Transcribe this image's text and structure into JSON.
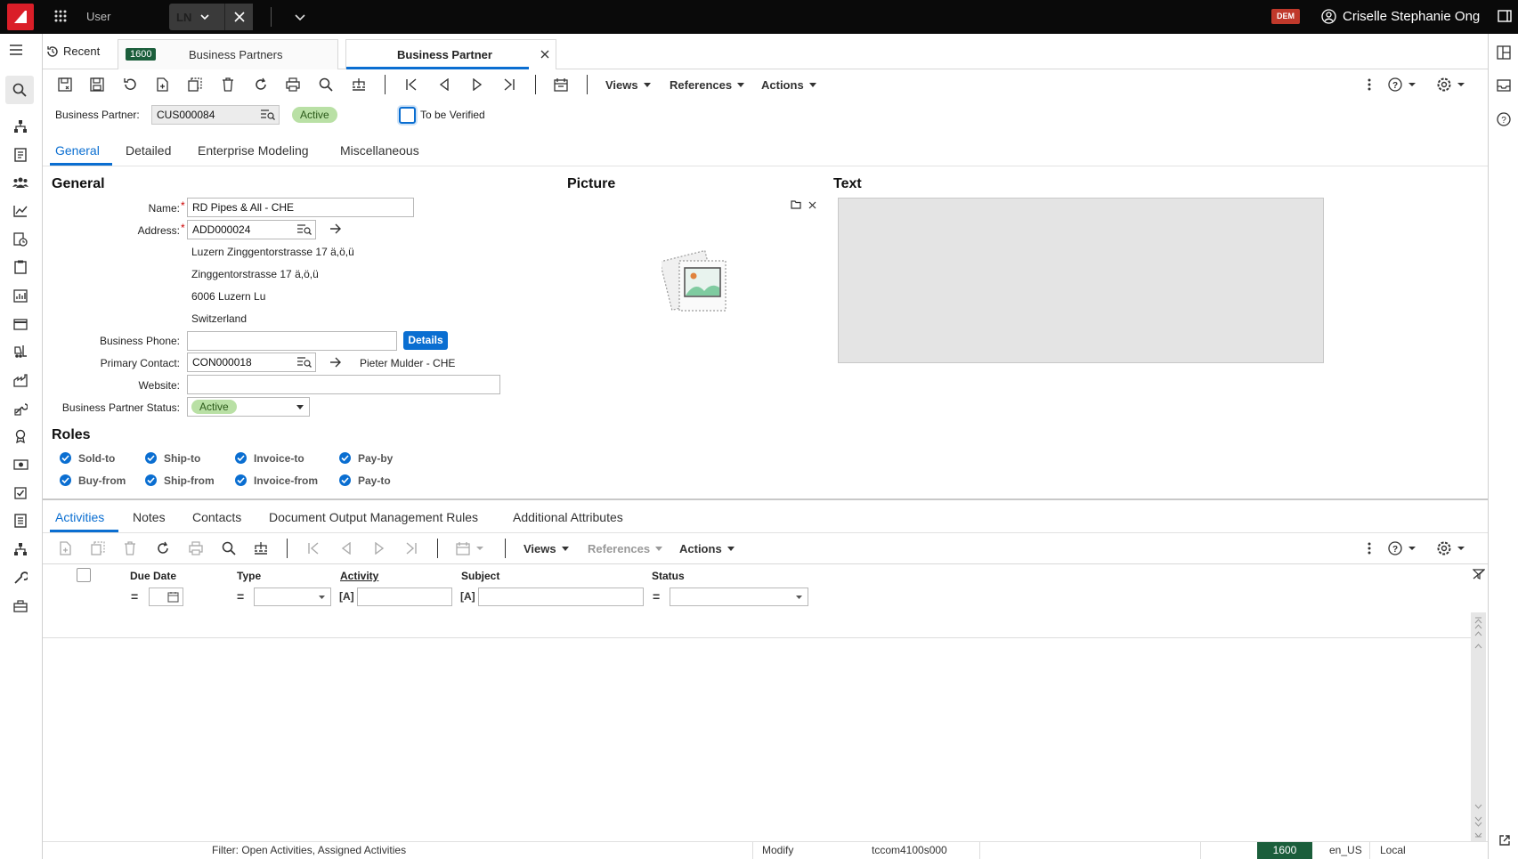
{
  "topbar": {
    "user_label": "User",
    "app_tab": "LN",
    "env_badge": "DEM",
    "user_name": "Criselle Stephanie Ong"
  },
  "session_tabs": {
    "recent": "Recent",
    "company_badge": "1600",
    "list_tab": "Business Partners",
    "active_tab": "Business Partner"
  },
  "toolbar": {
    "views": "Views",
    "references": "References",
    "actions": "Actions"
  },
  "header": {
    "bp_label": "Business Partner:",
    "bp_value": "CUS000084",
    "status": "Active",
    "verify_label": "To be Verified"
  },
  "subtabs": [
    "General",
    "Detailed",
    "Enterprise Modeling",
    "Miscellaneous"
  ],
  "general": {
    "title": "General",
    "name_label": "Name:",
    "name_value": "RD Pipes & All - CHE",
    "address_label": "Address:",
    "address_value": "ADD000024",
    "address_lines": [
      "Luzern Zinggentorstrasse 17 ä,ö,ü",
      "Zinggentorstrasse 17 ä,ö,ü",
      "6006  Luzern Lu",
      "Switzerland"
    ],
    "phone_label": "Business Phone:",
    "phone_value": "",
    "details_button": "Details",
    "contact_label": "Primary Contact:",
    "contact_value": "CON000018",
    "contact_name": "Pieter Mulder - CHE",
    "website_label": "Website:",
    "website_value": "",
    "bp_status_label": "Business Partner Status:",
    "bp_status_value": "Active"
  },
  "picture": {
    "title": "Picture"
  },
  "text": {
    "title": "Text"
  },
  "roles": {
    "title": "Roles",
    "items": [
      "Sold-to",
      "Ship-to",
      "Invoice-to",
      "Pay-by",
      "Buy-from",
      "Ship-from",
      "Invoice-from",
      "Pay-to"
    ]
  },
  "lower_tabs": [
    "Activities",
    "Notes",
    "Contacts",
    "Document Output Management Rules",
    "Additional Attributes"
  ],
  "lower_toolbar": {
    "views": "Views",
    "references": "References",
    "actions": "Actions"
  },
  "grid": {
    "columns": [
      "Due Date",
      "Type",
      "Activity",
      "Subject",
      "Status"
    ],
    "operators": [
      "=",
      "=",
      "[A]",
      "[A]",
      "="
    ]
  },
  "statusbar": {
    "filter": "Filter: Open Activities, Assigned Activities",
    "mode": "Modify",
    "session": "tccom4100s000",
    "company": "1600",
    "locale": "en_US",
    "timezone": "Local"
  },
  "colors": {
    "accent": "#0a6ed1",
    "active_status": "#b9e0a5",
    "brand_red": "#da1e28",
    "company_green": "#1b5e3b"
  }
}
